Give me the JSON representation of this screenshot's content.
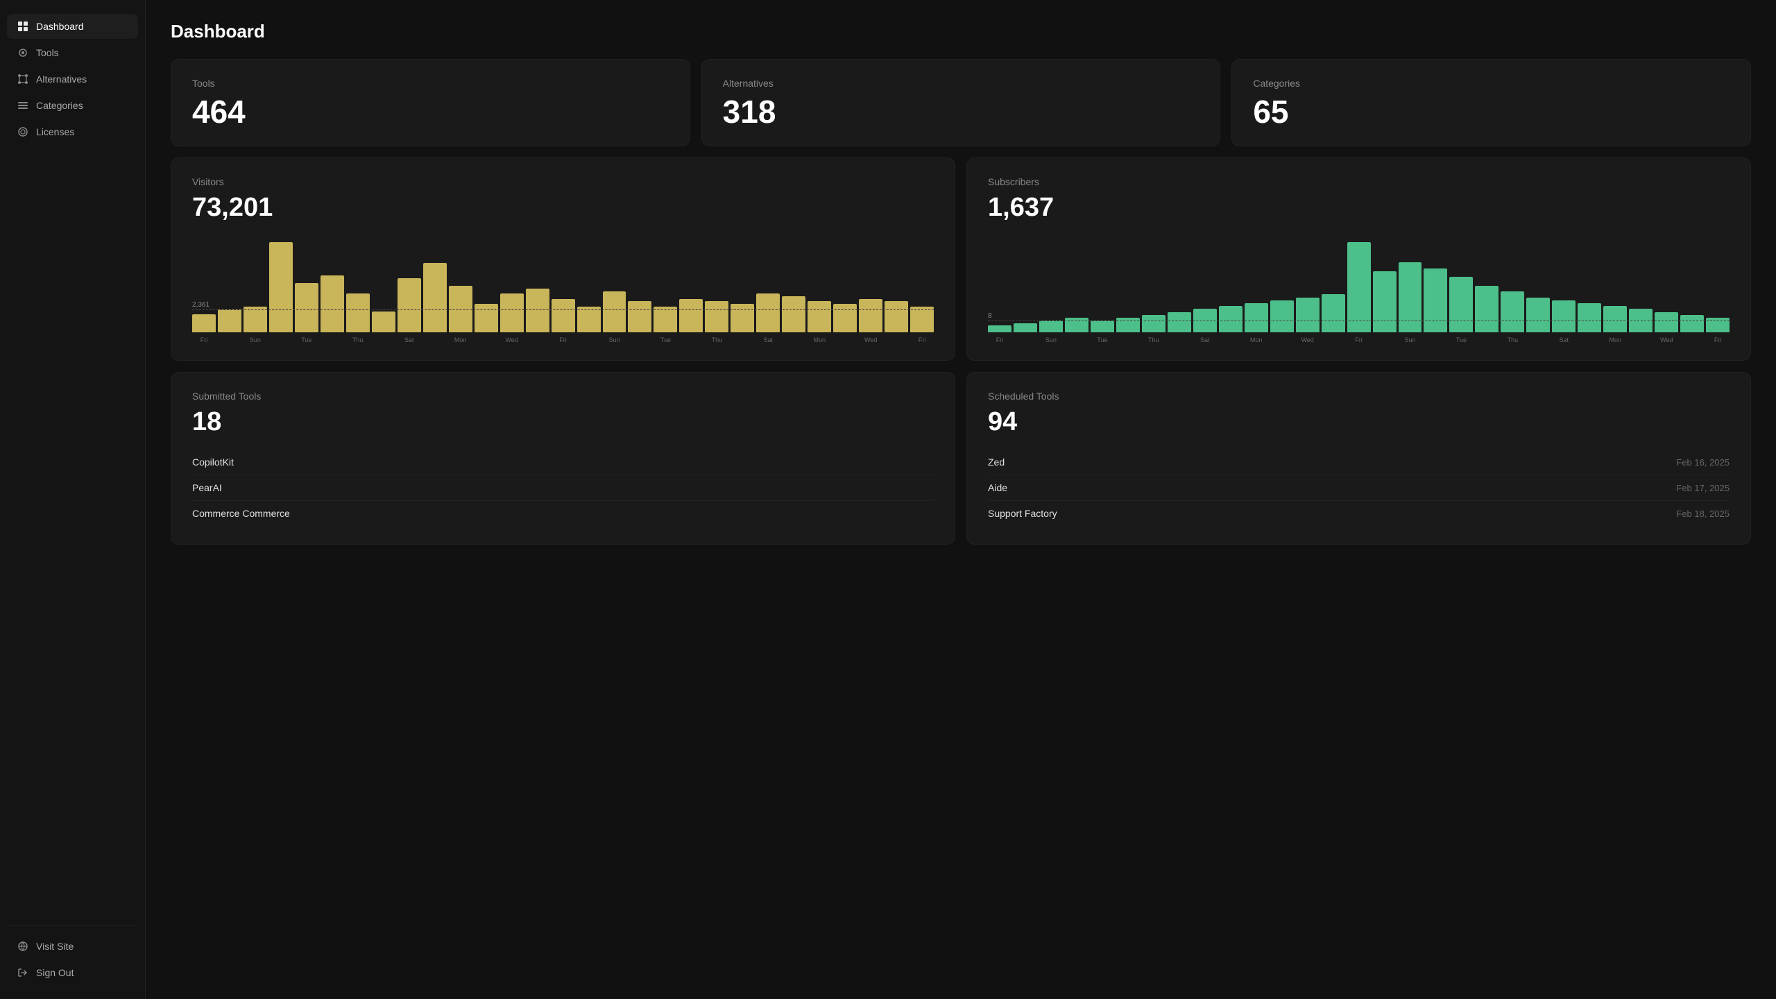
{
  "sidebar": {
    "items": [
      {
        "id": "dashboard",
        "label": "Dashboard",
        "active": true
      },
      {
        "id": "tools",
        "label": "Tools",
        "active": false
      },
      {
        "id": "alternatives",
        "label": "Alternatives",
        "active": false
      },
      {
        "id": "categories",
        "label": "Categories",
        "active": false
      },
      {
        "id": "licenses",
        "label": "Licenses",
        "active": false
      }
    ],
    "bottom_items": [
      {
        "id": "visit-site",
        "label": "Visit Site"
      },
      {
        "id": "sign-out",
        "label": "Sign Out"
      }
    ]
  },
  "page": {
    "title": "Dashboard"
  },
  "stats": [
    {
      "id": "tools",
      "label": "Tools",
      "value": "464"
    },
    {
      "id": "alternatives",
      "label": "Alternatives",
      "value": "318"
    },
    {
      "id": "categories",
      "label": "Categories",
      "value": "65"
    }
  ],
  "visitors": {
    "label": "Visitors",
    "value": "73,201",
    "avg_label": "2,361",
    "x_labels": [
      "Fri",
      "Sun",
      "Tue",
      "Thu",
      "Sat",
      "Mon",
      "Wed",
      "Fri",
      "Sun",
      "Tue",
      "Thu",
      "Sat",
      "Mon",
      "Wed",
      "Fri"
    ],
    "bars": [
      18,
      22,
      20,
      68,
      38,
      44,
      26,
      14,
      42,
      54,
      34,
      20,
      28,
      32,
      24,
      18,
      30,
      22,
      18,
      24,
      22,
      20,
      28,
      26,
      22,
      20,
      24,
      22,
      18
    ]
  },
  "subscribers": {
    "label": "Subscribers",
    "value": "1,637",
    "avg_label": "8",
    "x_labels": [
      "Fri",
      "Sun",
      "Tue",
      "Thu",
      "Sat",
      "Mon",
      "Wed",
      "Fri",
      "Sun",
      "Tue",
      "Thu",
      "Sat",
      "Mon",
      "Wed",
      "Fri"
    ],
    "bars": [
      6,
      8,
      10,
      12,
      10,
      12,
      14,
      16,
      18,
      20,
      22,
      24,
      26,
      28,
      58,
      40,
      46,
      42,
      36,
      30,
      26,
      22,
      20,
      18,
      16,
      14,
      12,
      10,
      8
    ]
  },
  "submitted_tools": {
    "label": "Submitted Tools",
    "value": "18",
    "items": [
      {
        "name": "CopilotKit",
        "date": ""
      },
      {
        "name": "PearAI",
        "date": ""
      },
      {
        "name": "Commerce Commerce",
        "date": ""
      }
    ]
  },
  "scheduled_tools": {
    "label": "Scheduled Tools",
    "value": "94",
    "items": [
      {
        "name": "Zed",
        "date": "Feb 16, 2025"
      },
      {
        "name": "Aide",
        "date": "Feb 17, 2025"
      },
      {
        "name": "Support Factory",
        "date": "Feb 18, 2025"
      }
    ]
  }
}
